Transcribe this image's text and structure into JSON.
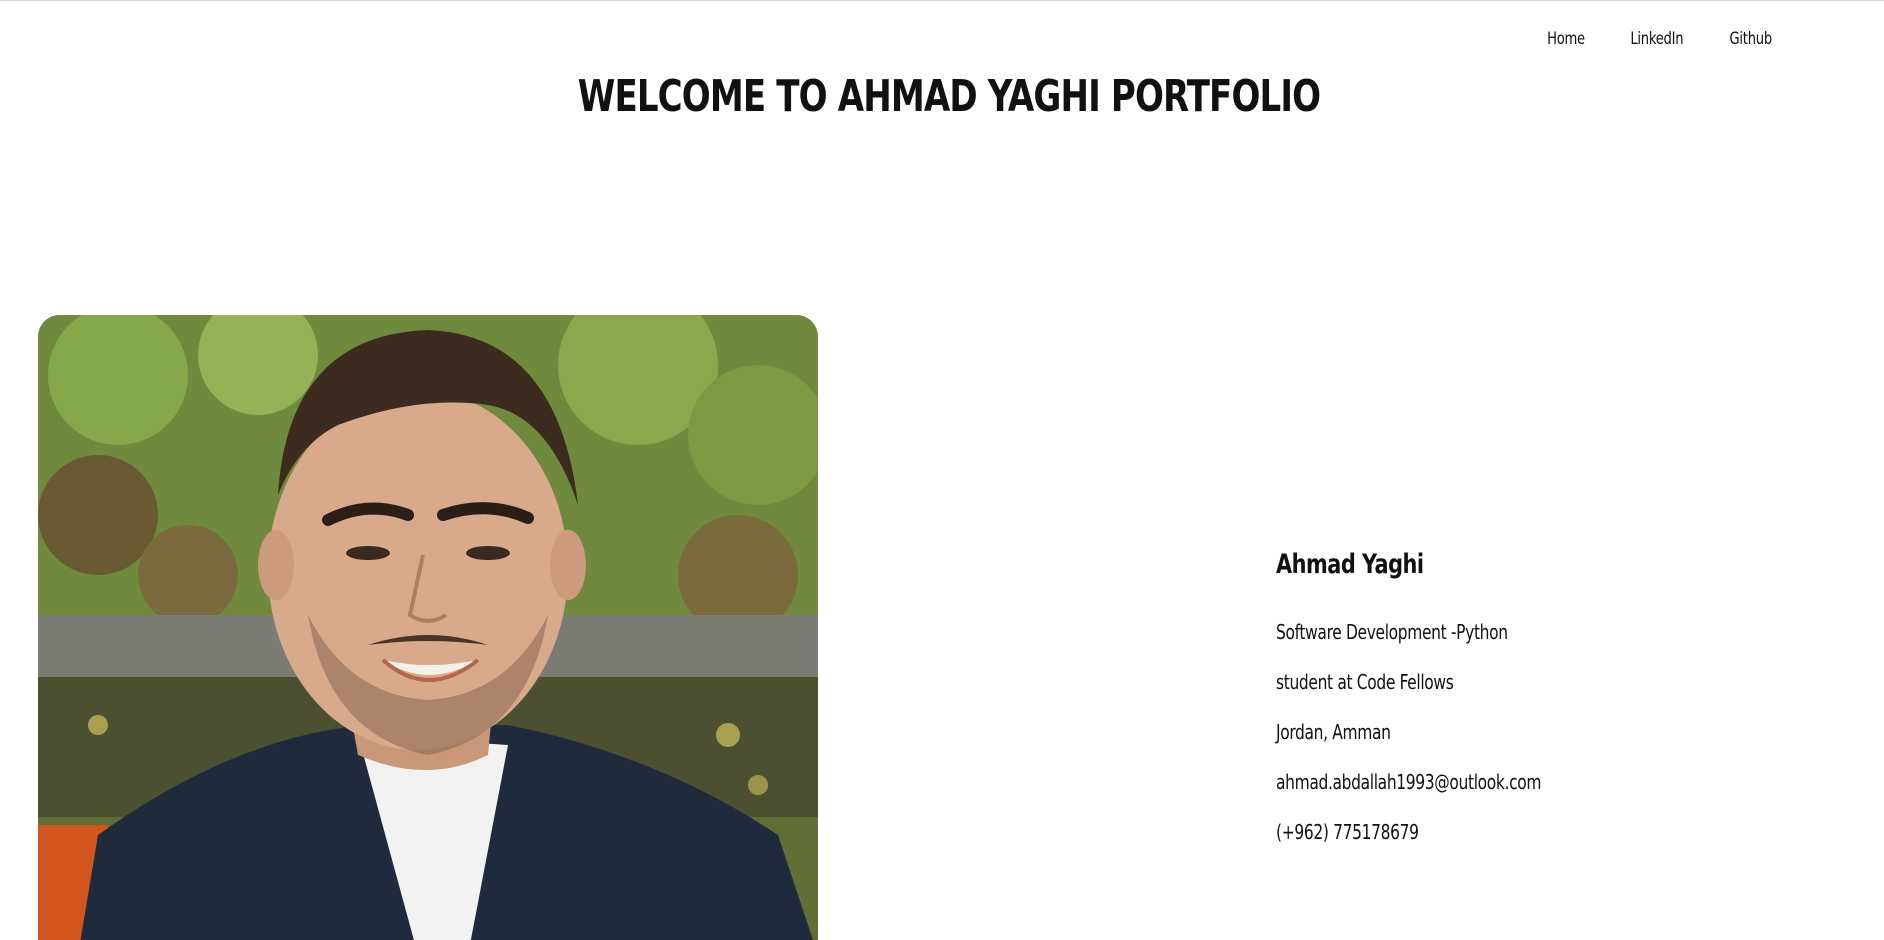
{
  "nav": {
    "items": [
      "Home",
      "LinkedIn",
      "Github"
    ]
  },
  "header": {
    "title": "WELCOME TO AHMAD YAGHI PORTFOLIO"
  },
  "profile": {
    "name": "Ahmad Yaghi",
    "details": [
      "Software Development -Python",
      "student at Code Fellows",
      "Jordan, Amman",
      "ahmad.abdallah1993@outlook.com",
      "(+962) 775178679"
    ]
  }
}
